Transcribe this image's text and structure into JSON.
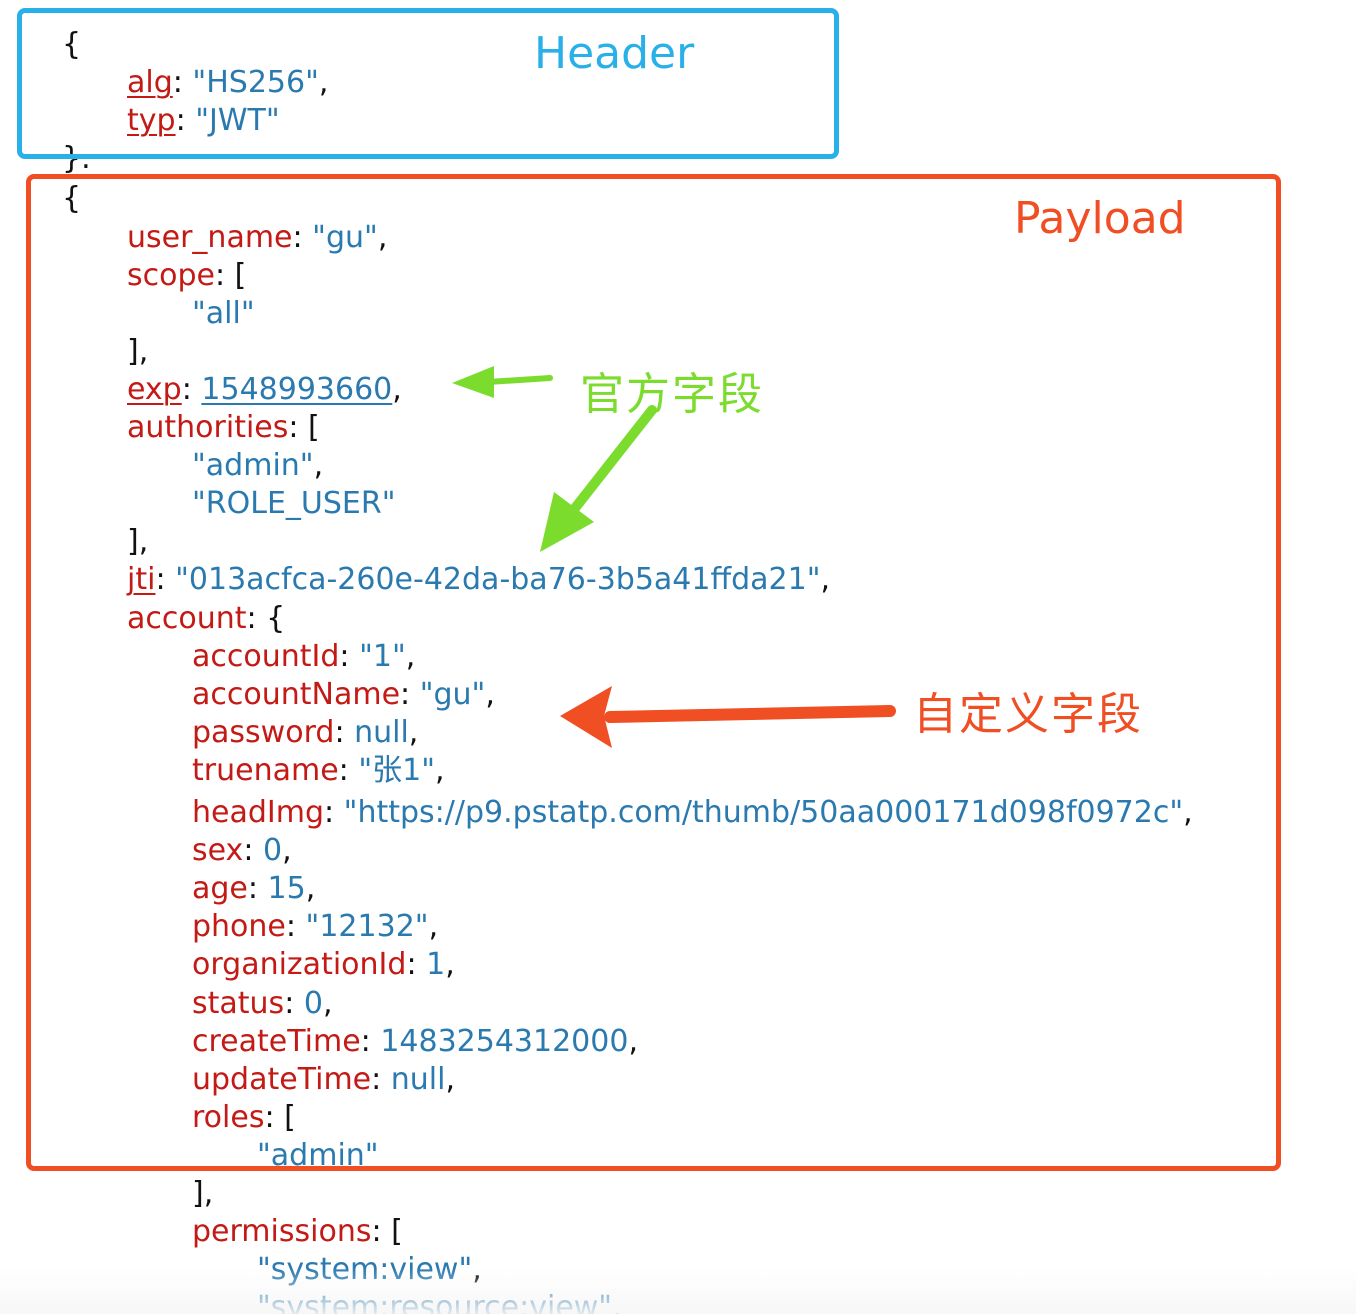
{
  "annotations": {
    "header_label": "Header",
    "payload_label": "Payload",
    "official_fields_label": "官方字段",
    "custom_fields_label": "自定义字段"
  },
  "colors": {
    "key": "#c41a16",
    "value": "#2a7ab0",
    "punctuation": "#111111",
    "header_box": "#29b0e8",
    "payload_box": "#f04e23",
    "official_arrow": "#7bdc2e",
    "custom_arrow": "#f04e23"
  },
  "json_view": {
    "lines": [
      {
        "indent": 0,
        "segs": [
          {
            "t": "{",
            "c": "p"
          }
        ]
      },
      {
        "indent": 1,
        "segs": [
          {
            "t": "alg",
            "c": "k",
            "u": true
          },
          {
            "t": ": ",
            "c": "p"
          },
          {
            "t": "\"HS256\"",
            "c": "v"
          },
          {
            "t": ",",
            "c": "p"
          }
        ]
      },
      {
        "indent": 1,
        "segs": [
          {
            "t": "typ",
            "c": "k",
            "u": true
          },
          {
            "t": ": ",
            "c": "p"
          },
          {
            "t": "\"JWT\"",
            "c": "v"
          }
        ]
      },
      {
        "indent": 0,
        "segs": [
          {
            "t": "}.",
            "c": "p"
          }
        ]
      },
      {
        "indent": 0,
        "segs": [
          {
            "t": "{",
            "c": "p"
          }
        ]
      },
      {
        "indent": 1,
        "segs": [
          {
            "t": "user_name",
            "c": "k"
          },
          {
            "t": ": ",
            "c": "p"
          },
          {
            "t": "\"gu\"",
            "c": "v"
          },
          {
            "t": ",",
            "c": "p"
          }
        ]
      },
      {
        "indent": 1,
        "segs": [
          {
            "t": "scope",
            "c": "k"
          },
          {
            "t": ": [",
            "c": "p"
          }
        ]
      },
      {
        "indent": 2,
        "segs": [
          {
            "t": "\"all\"",
            "c": "v"
          }
        ]
      },
      {
        "indent": 1,
        "segs": [
          {
            "t": "],",
            "c": "p"
          }
        ]
      },
      {
        "indent": 1,
        "segs": [
          {
            "t": "exp",
            "c": "k",
            "u": true
          },
          {
            "t": ": ",
            "c": "p"
          },
          {
            "t": "1548993660",
            "c": "v",
            "u": true
          },
          {
            "t": ",",
            "c": "p"
          }
        ]
      },
      {
        "indent": 1,
        "segs": [
          {
            "t": "authorities",
            "c": "k"
          },
          {
            "t": ": [",
            "c": "p"
          }
        ]
      },
      {
        "indent": 2,
        "segs": [
          {
            "t": "\"admin\"",
            "c": "v"
          },
          {
            "t": ",",
            "c": "p"
          }
        ]
      },
      {
        "indent": 2,
        "segs": [
          {
            "t": "\"ROLE_USER\"",
            "c": "v"
          }
        ]
      },
      {
        "indent": 1,
        "segs": [
          {
            "t": "],",
            "c": "p"
          }
        ]
      },
      {
        "indent": 1,
        "segs": [
          {
            "t": "jti",
            "c": "k",
            "u": true
          },
          {
            "t": ": ",
            "c": "p"
          },
          {
            "t": "\"013acfca-260e-42da-ba76-3b5a41ffda21\"",
            "c": "v"
          },
          {
            "t": ",",
            "c": "p"
          }
        ]
      },
      {
        "indent": 1,
        "segs": [
          {
            "t": "account",
            "c": "k"
          },
          {
            "t": ": {",
            "c": "p"
          }
        ]
      },
      {
        "indent": 2,
        "segs": [
          {
            "t": "accountId",
            "c": "k"
          },
          {
            "t": ": ",
            "c": "p"
          },
          {
            "t": "\"1\"",
            "c": "v"
          },
          {
            "t": ",",
            "c": "p"
          }
        ]
      },
      {
        "indent": 2,
        "segs": [
          {
            "t": "accountName",
            "c": "k"
          },
          {
            "t": ": ",
            "c": "p"
          },
          {
            "t": "\"gu\"",
            "c": "v"
          },
          {
            "t": ",",
            "c": "p"
          }
        ]
      },
      {
        "indent": 2,
        "segs": [
          {
            "t": "password",
            "c": "k"
          },
          {
            "t": ": ",
            "c": "p"
          },
          {
            "t": "null",
            "c": "v"
          },
          {
            "t": ",",
            "c": "p"
          }
        ]
      },
      {
        "indent": 2,
        "segs": [
          {
            "t": "truename",
            "c": "k"
          },
          {
            "t": ": ",
            "c": "p"
          },
          {
            "t": "\"张1\"",
            "c": "v"
          },
          {
            "t": ",",
            "c": "p"
          }
        ]
      },
      {
        "indent": 2,
        "segs": [
          {
            "t": "headImg",
            "c": "k"
          },
          {
            "t": ": ",
            "c": "p"
          },
          {
            "t": "\"https://p9.pstatp.com/thumb/50aa000171d098f0972c\"",
            "c": "v"
          },
          {
            "t": ",",
            "c": "p"
          }
        ]
      },
      {
        "indent": 2,
        "segs": [
          {
            "t": "sex",
            "c": "k"
          },
          {
            "t": ": ",
            "c": "p"
          },
          {
            "t": "0",
            "c": "v"
          },
          {
            "t": ",",
            "c": "p"
          }
        ]
      },
      {
        "indent": 2,
        "segs": [
          {
            "t": "age",
            "c": "k"
          },
          {
            "t": ": ",
            "c": "p"
          },
          {
            "t": "15",
            "c": "v"
          },
          {
            "t": ",",
            "c": "p"
          }
        ]
      },
      {
        "indent": 2,
        "segs": [
          {
            "t": "phone",
            "c": "k"
          },
          {
            "t": ": ",
            "c": "p"
          },
          {
            "t": "\"12132\"",
            "c": "v"
          },
          {
            "t": ",",
            "c": "p"
          }
        ]
      },
      {
        "indent": 2,
        "segs": [
          {
            "t": "organizationId",
            "c": "k"
          },
          {
            "t": ": ",
            "c": "p"
          },
          {
            "t": "1",
            "c": "v"
          },
          {
            "t": ",",
            "c": "p"
          }
        ]
      },
      {
        "indent": 2,
        "segs": [
          {
            "t": "status",
            "c": "k"
          },
          {
            "t": ": ",
            "c": "p"
          },
          {
            "t": "0",
            "c": "v"
          },
          {
            "t": ",",
            "c": "p"
          }
        ]
      },
      {
        "indent": 2,
        "segs": [
          {
            "t": "createTime",
            "c": "k"
          },
          {
            "t": ": ",
            "c": "p"
          },
          {
            "t": "1483254312000",
            "c": "v"
          },
          {
            "t": ",",
            "c": "p"
          }
        ]
      },
      {
        "indent": 2,
        "segs": [
          {
            "t": "updateTime",
            "c": "k"
          },
          {
            "t": ": ",
            "c": "p"
          },
          {
            "t": "null",
            "c": "v"
          },
          {
            "t": ",",
            "c": "p"
          }
        ]
      },
      {
        "indent": 2,
        "segs": [
          {
            "t": "roles",
            "c": "k"
          },
          {
            "t": ": [",
            "c": "p"
          }
        ]
      },
      {
        "indent": 3,
        "segs": [
          {
            "t": "\"admin\"",
            "c": "v"
          }
        ]
      },
      {
        "indent": 2,
        "segs": [
          {
            "t": "],",
            "c": "p"
          }
        ]
      },
      {
        "indent": 2,
        "segs": [
          {
            "t": "permissions",
            "c": "k"
          },
          {
            "t": ": [",
            "c": "p"
          }
        ]
      },
      {
        "indent": 3,
        "segs": [
          {
            "t": "\"system:view\"",
            "c": "v"
          },
          {
            "t": ",",
            "c": "p"
          }
        ]
      },
      {
        "indent": 3,
        "segs": [
          {
            "t": "\"system:resource:view\"",
            "c": "v"
          },
          {
            "t": ",",
            "c": "p"
          }
        ]
      }
    ]
  }
}
